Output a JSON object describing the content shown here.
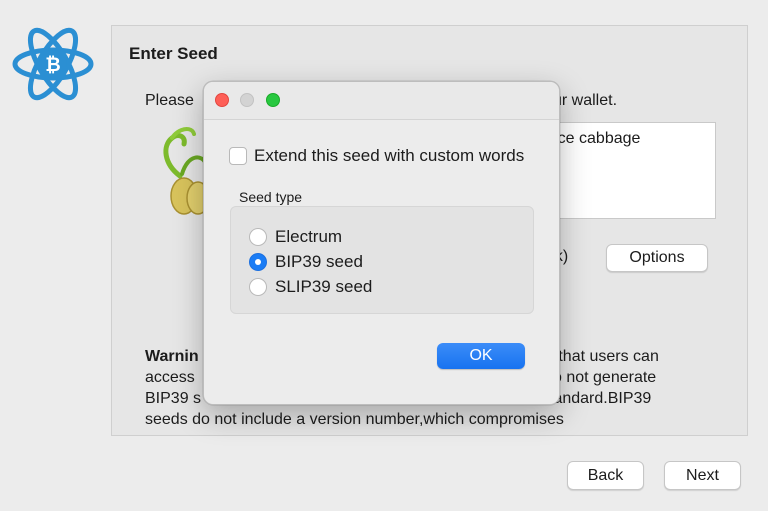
{
  "colors": {
    "accent": "#1a7cf5",
    "logo_blue": "#2b8fd3",
    "traffic_close": "#fe5f57",
    "traffic_maximize": "#28c840"
  },
  "wizard": {
    "title": "Enter Seed",
    "instruction_start": "Please",
    "instruction_end": "ur wallet.",
    "seed_text_visible": "rface cabbage",
    "bip39_suffix": "ok)",
    "options_label": "Options",
    "warning_lines": [
      {
        "bold": "Warnin",
        "text": "",
        "tail": "so that users can"
      },
      {
        "bold": "",
        "text": "access",
        "tail": "o not generate"
      },
      {
        "bold": "",
        "text": "BIP39 s",
        "tail": "tandard.BIP39"
      },
      {
        "bold": "",
        "text": "seeds do not include a version number,which compromises",
        "tail": ""
      }
    ],
    "back_label": "Back",
    "next_label": "Next"
  },
  "dialog": {
    "extend_label": "Extend this seed with custom words",
    "extend_checked": false,
    "seed_type_label": "Seed type",
    "seed_types": [
      {
        "label": "Electrum",
        "selected": false
      },
      {
        "label": "BIP39 seed",
        "selected": true
      },
      {
        "label": "SLIP39 seed",
        "selected": false
      }
    ],
    "ok_label": "OK"
  },
  "icons": {
    "logo": "electrum-bitcoin-logo-icon",
    "sprout": "seed-sprout-icon",
    "close": "window-close-icon",
    "minimize": "window-minimize-icon",
    "maximize": "window-maximize-icon"
  }
}
